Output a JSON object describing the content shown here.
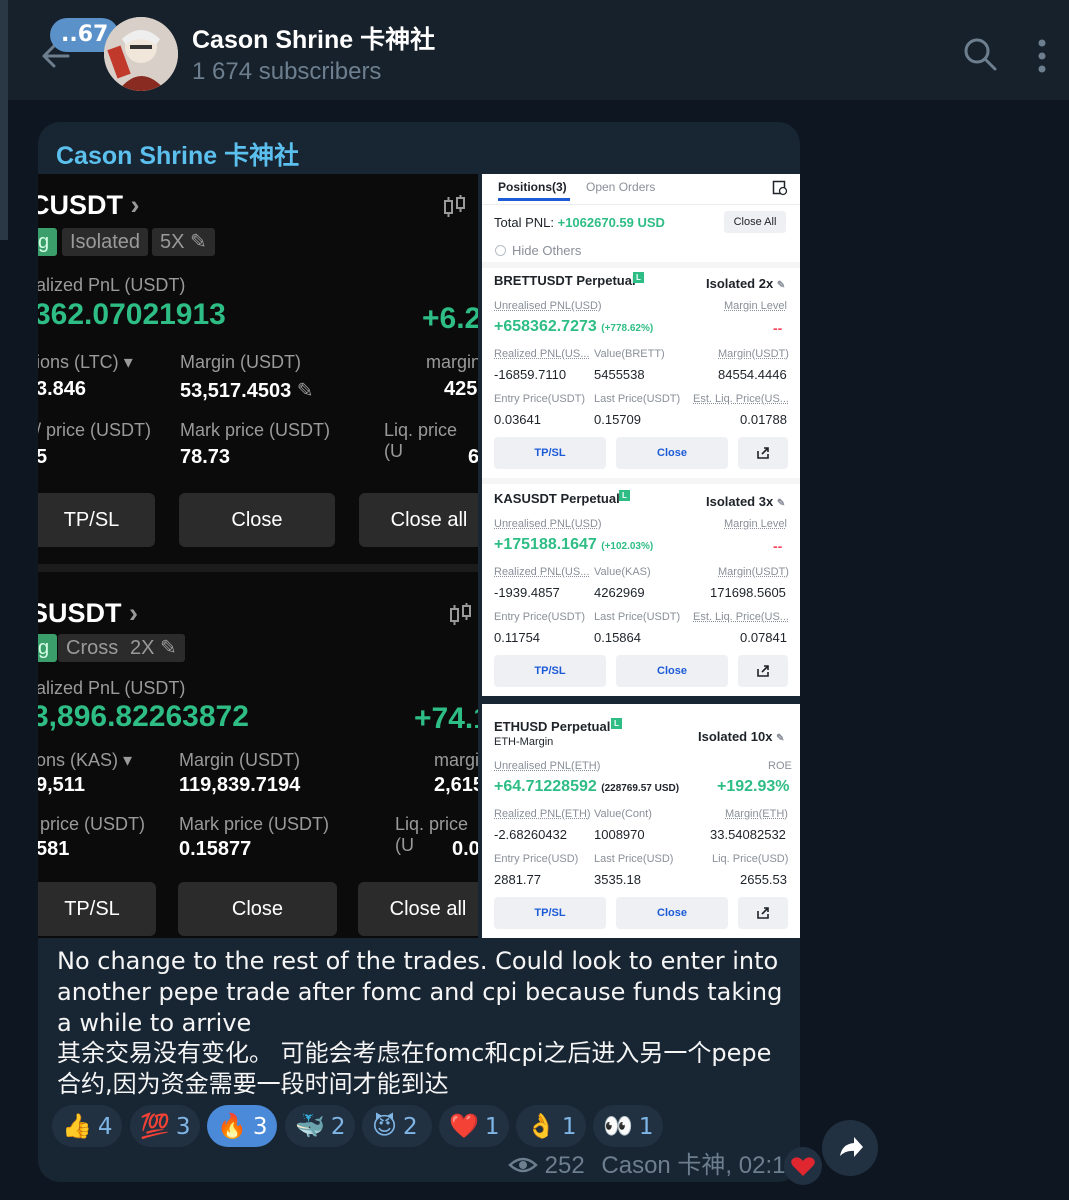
{
  "header": {
    "unread_badge": "..67",
    "title": "Cason Shrine 卡神社",
    "subtitle": "1 674 subscribers"
  },
  "message": {
    "sender": "Cason Shrine 卡神社",
    "text_en": "No change to the rest of the trades. Could look to enter into another pepe trade after fomc and cpi because funds taking a while to arrive",
    "text_cn": "其余交易没有变化。 可能会考虑在fomc和cpi之后进入另一个pepe合约,因为资金需要一段时间才能到达",
    "views": "252",
    "author_time": "Cason 卡神, 02:18"
  },
  "reactions": [
    {
      "emoji": "👍",
      "count": "4"
    },
    {
      "emoji": "💯",
      "count": "3"
    },
    {
      "emoji": "🔥",
      "count": "3"
    },
    {
      "emoji": "🐳",
      "count": "2"
    },
    {
      "emoji": "😈",
      "count": "2"
    },
    {
      "emoji": "❤️",
      "count": "1"
    },
    {
      "emoji": "👌",
      "count": "1"
    },
    {
      "emoji": "👀",
      "count": "1"
    }
  ],
  "dark_cards": [
    {
      "symbol": "CUSDT",
      "tag1": "g",
      "tag2": "Isolated",
      "leverage": "5X",
      "pnl_label": "alized PnL (USDT)",
      "pnl_value": "362.07021913",
      "pnl_right": "+6.2",
      "pos_label": "ions (LTC)",
      "pos_value": "3.846",
      "margin_label": "Margin (USDT)",
      "margin_value": "53,517.4503",
      "margin_r_label": "margin",
      "margin_r_value": "425",
      "entry_label": "price (USDT)",
      "entry_value": "5",
      "mark_label": "Mark price (USDT)",
      "mark_value": "78.73",
      "liq_label": "Liq. price (U",
      "liq_value": "6",
      "btn_tpsl": "TP/SL",
      "btn_close": "Close",
      "btn_closeall": "Close all"
    },
    {
      "symbol": "SUSDT",
      "tag1": "g",
      "tag2": "Cross",
      "leverage": "2X",
      "pnl_label": "alized PnL (USDT)",
      "pnl_value": "3,896.82263872",
      "pnl_right": "+74.1",
      "pos_label": "ons (KAS)",
      "pos_value": "9,511",
      "margin_label": "Margin (USDT)",
      "margin_value": "119,839.7194",
      "margin_r_label": "margi",
      "margin_r_value": "2,615",
      "entry_label": "price (USDT)",
      "entry_value": "581",
      "mark_label": "Mark price (USDT)",
      "mark_value": "0.15877",
      "liq_label": "Liq. price (U",
      "liq_value": "0.0",
      "btn_tpsl": "TP/SL",
      "btn_close": "Close",
      "btn_closeall": "Close all"
    }
  ],
  "positions": {
    "tab_active": "Positions(3)",
    "tab_other": "Open Orders",
    "total_pnl_label": "Total PNL:",
    "total_pnl_value": "+1062670.59 USD",
    "close_all": "Close All",
    "hide_others": "Hide Others",
    "items": [
      {
        "symbol": "BRETTUSDT Perpetual",
        "mode": "Isolated 2x",
        "unrealised_label": "Unrealised PNL(USD)",
        "margin_level_label": "Margin Level",
        "unrealised_value": "+658362.7273",
        "unrealised_pct": "(+778.62%)",
        "margin_level_value": "--",
        "realized_label": "Realized PNL(US...",
        "value_label": "Value(BRETT)",
        "margin_label": "Margin(USDT)",
        "realized_value": "-16859.7110",
        "value_value": "5455538",
        "margin_value": "84554.4446",
        "entry_label": "Entry Price(USDT)",
        "last_label": "Last Price(USDT)",
        "liq_label": "Est. Liq. Price(US...",
        "entry_value": "0.03641",
        "last_value": "0.15709",
        "liq_value": "0.01788",
        "btn_tpsl": "TP/SL",
        "btn_close": "Close"
      },
      {
        "symbol": "KASUSDT Perpetual",
        "mode": "Isolated 3x",
        "unrealised_label": "Unrealised PNL(USD)",
        "margin_level_label": "Margin Level",
        "unrealised_value": "+175188.1647",
        "unrealised_pct": "(+102.03%)",
        "margin_level_value": "--",
        "realized_label": "Realized PNL(US...",
        "value_label": "Value(KAS)",
        "margin_label": "Margin(USDT)",
        "realized_value": "-1939.4857",
        "value_value": "4262969",
        "margin_value": "171698.5605",
        "entry_label": "Entry Price(USDT)",
        "last_label": "Last Price(USDT)",
        "liq_label": "Est. Liq. Price(US...",
        "entry_value": "0.11754",
        "last_value": "0.15864",
        "liq_value": "0.07841",
        "btn_tpsl": "TP/SL",
        "btn_close": "Close"
      }
    ],
    "eth": {
      "symbol": "ETHUSD Perpetual",
      "sub": "ETH-Margin",
      "mode": "Isolated 10x",
      "unrealised_label": "Unrealised PNL(ETH)",
      "roe_label": "ROE",
      "unrealised_value": "+64.71228592",
      "unrealised_usd": "(228769.57 USD)",
      "roe_value": "+192.93%",
      "realized_label": "Realized PNL(ETH)",
      "value_label": "Value(Cont)",
      "margin_label": "Margin(ETH)",
      "realized_value": "-2.68260432",
      "value_value": "1008970",
      "margin_value": "33.54082532",
      "entry_label": "Entry Price(USD)",
      "last_label": "Last Price(USD)",
      "liq_label": "Liq. Price(USD)",
      "entry_value": "2881.77",
      "last_value": "3535.18",
      "liq_value": "2655.53",
      "btn_tpsl": "TP/SL",
      "btn_close": "Close"
    }
  },
  "colors": {
    "bg": "#0e1621",
    "bubble": "#182533",
    "sender": "#5cc0ee",
    "green": "#2ebd85",
    "red": "#f6465d",
    "link_blue": "#1d5bd6"
  }
}
